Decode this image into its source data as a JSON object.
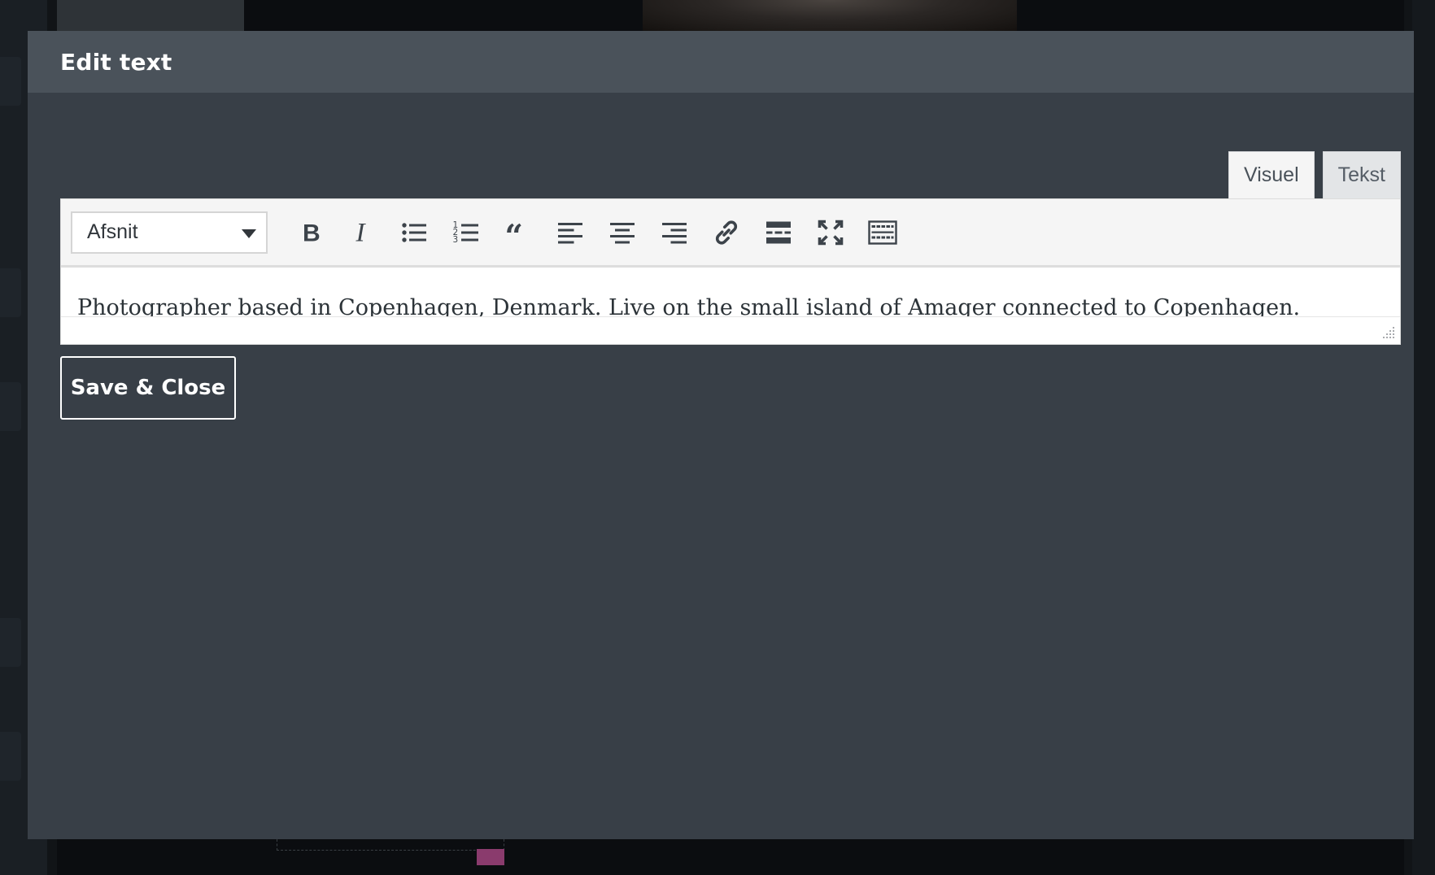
{
  "modal": {
    "title": "Edit text"
  },
  "editor": {
    "tabs": [
      {
        "label": "Visuel",
        "active": true
      },
      {
        "label": "Tekst",
        "active": false
      }
    ],
    "format_select": {
      "value": "Afsnit"
    },
    "toolbar_icons": [
      "bold-icon",
      "italic-icon",
      "bullet-list-icon",
      "numbered-list-icon",
      "blockquote-icon",
      "align-left-icon",
      "align-center-icon",
      "align-right-icon",
      "link-icon",
      "read-more-icon",
      "fullscreen-icon",
      "toolbar-toggle-icon"
    ],
    "content": "Photographer based in Copenhagen, Denmark. Live on the small island of Amager connected to Copenhagen."
  },
  "actions": {
    "save_close_label": "Save & Close"
  },
  "colors": {
    "modal_bg": "#383f47",
    "header_bg": "#4a525a",
    "toolbar_bg": "#f5f5f5",
    "text_dark": "#3c434a"
  }
}
